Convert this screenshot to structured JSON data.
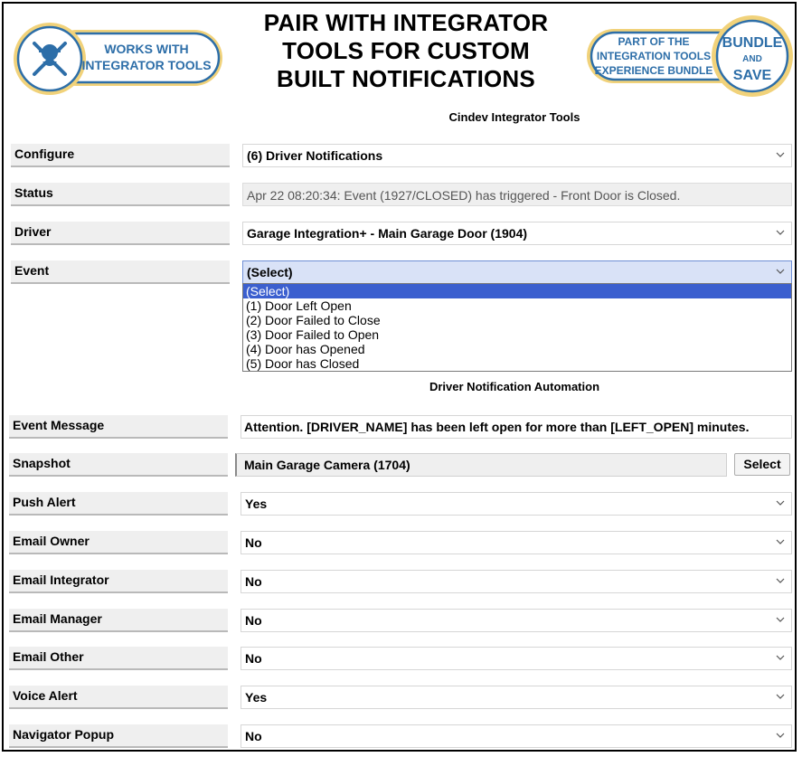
{
  "banner": {
    "left_badge": {
      "line1": "WORKS WITH",
      "line2": "INTEGRATOR TOOLS"
    },
    "title_lines": [
      "PAIR WITH INTEGRATOR",
      "TOOLS FOR CUSTOM",
      "BUILT NOTIFICATIONS"
    ],
    "right_badge": {
      "line1": "PART OF THE",
      "line2": "INTEGRATION TOOLS",
      "line3": "EXPERIENCE BUNDLE",
      "seal_top": "BUNDLE",
      "seal_mid": "AND",
      "seal_bottom": "SAVE"
    },
    "colors": {
      "badge_blue": "#2d6ea8",
      "badge_gold": "#f1d27a"
    }
  },
  "app_title": "Cindev Integrator Tools",
  "rows": {
    "configure": {
      "label": "Configure",
      "value": "(6) Driver Notifications"
    },
    "status": {
      "label": "Status",
      "value": "Apr 22 08:20:34: Event (1927/CLOSED) has triggered - Front Door is Closed."
    },
    "driver": {
      "label": "Driver",
      "value": "Garage Integration+ - Main Garage Door (1904)"
    },
    "event": {
      "label": "Event",
      "value": "(Select)"
    }
  },
  "event_dropdown": {
    "options": [
      "(Select)",
      "(1) Door Left Open",
      "(2) Door Failed to Close",
      "(3) Door Failed to Open",
      "(4) Door has Opened",
      "(5) Door has Closed"
    ],
    "selected_index": 0
  },
  "section_title": "Driver Notification Automation",
  "automation": {
    "event_message": {
      "label": "Event Message",
      "value": "Attention. [DRIVER_NAME] has been left open for more than [LEFT_OPEN] minutes."
    },
    "snapshot": {
      "label": "Snapshot",
      "value": "Main Garage Camera (1704)",
      "button": "Select"
    },
    "push_alert": {
      "label": "Push Alert",
      "value": "Yes"
    },
    "email_owner": {
      "label": "Email Owner",
      "value": "No"
    },
    "email_integrator": {
      "label": "Email Integrator",
      "value": "No"
    },
    "email_manager": {
      "label": "Email Manager",
      "value": "No"
    },
    "email_other": {
      "label": "Email Other",
      "value": "No"
    },
    "voice_alert": {
      "label": "Voice Alert",
      "value": "Yes"
    },
    "navigator_popup": {
      "label": "Navigator Popup",
      "value": "No"
    }
  },
  "icons": {
    "chevron": "chevron-down-icon",
    "tools": "wrench-hammer-icon"
  }
}
